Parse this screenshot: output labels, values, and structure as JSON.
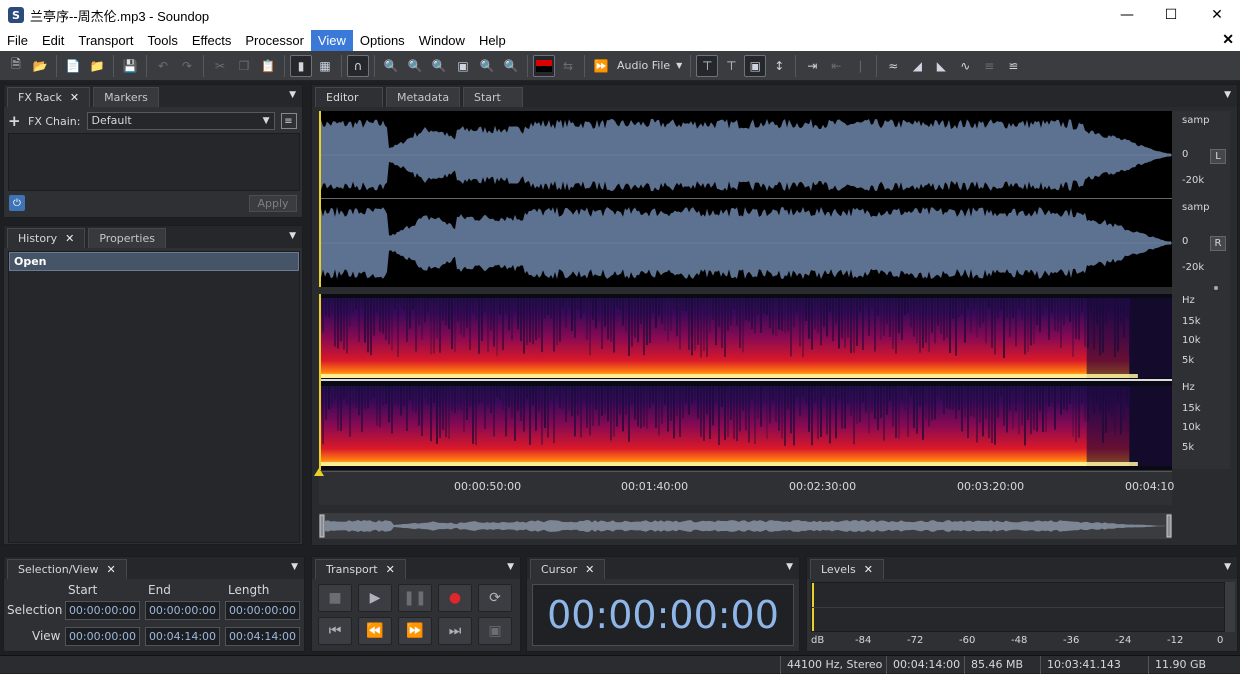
{
  "window": {
    "title": "兰亭序--周杰伦.mp3 - Soundop",
    "app_icon": "S"
  },
  "menu": [
    "File",
    "Edit",
    "Transport",
    "Tools",
    "Effects",
    "Processor",
    "View",
    "Options",
    "Window",
    "Help"
  ],
  "toolbar": {
    "audio_file_label": "Audio File"
  },
  "fx_rack": {
    "tabs": [
      "FX Rack",
      "Markers"
    ],
    "chain_label": "FX Chain:",
    "chain_value": "Default",
    "apply_label": "Apply"
  },
  "history": {
    "tabs": [
      "History",
      "Properties"
    ],
    "items": [
      "Open"
    ]
  },
  "editor": {
    "tabs": [
      "Editor",
      "Metadata",
      "Start"
    ],
    "wave_scale": {
      "top": "samp",
      "mid": "0",
      "bot": "-20k"
    },
    "channels": [
      "L",
      "R"
    ],
    "spec_scale": [
      "Hz",
      "15k",
      "10k",
      "5k"
    ],
    "ruler": [
      "00:00:50:00",
      "00:01:40:00",
      "00:02:30:00",
      "00:03:20:00",
      "00:04:10"
    ]
  },
  "selection_view": {
    "tab": "Selection/View",
    "headers": [
      "Start",
      "End",
      "Length"
    ],
    "rows": [
      {
        "label": "Selection",
        "values": [
          "00:00:00:00",
          "00:00:00:00",
          "00:00:00:00"
        ]
      },
      {
        "label": "View",
        "values": [
          "00:00:00:00",
          "00:04:14:00",
          "00:04:14:00"
        ]
      }
    ]
  },
  "transport": {
    "tab": "Transport"
  },
  "cursor": {
    "tab": "Cursor",
    "time": "00:00:00:00"
  },
  "levels": {
    "tab": "Levels",
    "scale": [
      "dB",
      "-84",
      "-72",
      "-60",
      "-48",
      "-36",
      "-24",
      "-12",
      "0"
    ]
  },
  "status": {
    "format": "44100 Hz, Stereo",
    "duration": "00:04:14:00",
    "size": "85.46 MB",
    "position": "10:03:41.143",
    "free": "11.90 GB"
  },
  "colors": {
    "accent": "#3b79d8",
    "wave": "#5d7290",
    "timecode": "#8fb6e8"
  }
}
